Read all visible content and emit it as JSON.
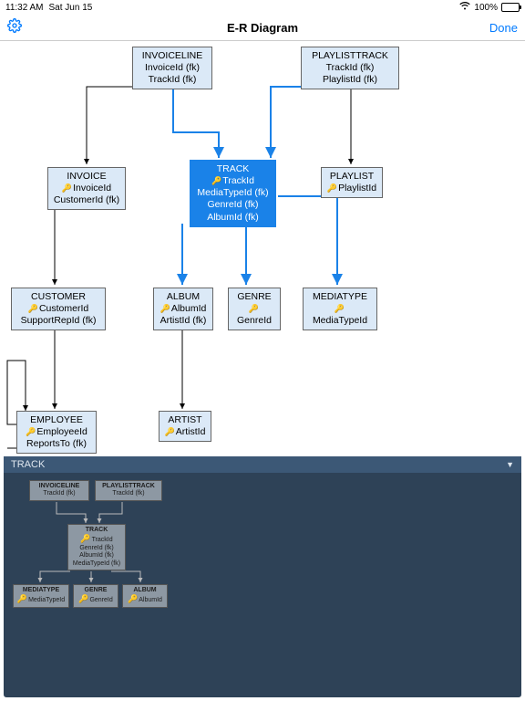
{
  "status": {
    "time": "11:32 AM",
    "date": "Sat Jun 15",
    "wifi": "wifi-icon",
    "battery_pct": "100%"
  },
  "nav": {
    "title": "E-R Diagram",
    "done": "Done"
  },
  "detail": {
    "title": "TRACK"
  },
  "entities": {
    "invoiceline": {
      "title": "INVOICELINE",
      "f1": "InvoiceId (fk)",
      "f2": "TrackId (fk)"
    },
    "playlisttrack": {
      "title": "PLAYLISTTRACK",
      "f1": "TrackId (fk)",
      "f2": "PlaylistId (fk)"
    },
    "invoice": {
      "title": "INVOICE",
      "f1": "InvoiceId",
      "f2": "CustomerId (fk)"
    },
    "track": {
      "title": "TRACK",
      "f1": "TrackId",
      "f2": "MediaTypeId (fk)",
      "f3": "GenreId (fk)",
      "f4": "AlbumId (fk)"
    },
    "playlist": {
      "title": "PLAYLIST",
      "f1": "PlaylistId"
    },
    "customer": {
      "title": "CUSTOMER",
      "f1": "CustomerId",
      "f2": "SupportRepId (fk)"
    },
    "album": {
      "title": "ALBUM",
      "f1": "AlbumId",
      "f2": "ArtistId (fk)"
    },
    "genre": {
      "title": "GENRE",
      "f1": "GenreId"
    },
    "mediatype": {
      "title": "MEDIATYPE",
      "f1": "MediaTypeId"
    },
    "employee": {
      "title": "EMPLOYEE",
      "f1": "EmployeeId",
      "f2": "ReportsTo (fk)"
    },
    "artist": {
      "title": "ARTIST",
      "f1": "ArtistId"
    }
  },
  "mini": {
    "invoiceline": {
      "title": "INVOICELINE",
      "f1": "TrackId (fk)"
    },
    "playlisttrack": {
      "title": "PLAYLISTTRACK",
      "f1": "TrackId (fk)"
    },
    "track": {
      "title": "TRACK",
      "f1": "TrackId",
      "f2": "GenreId (fk)",
      "f3": "AlbumId (fk)",
      "f4": "MediaTypeId (fk)"
    },
    "mediatype": {
      "title": "MEDIATYPE",
      "f1": "MediaTypeId"
    },
    "genre": {
      "title": "GENRE",
      "f1": "GenreId"
    },
    "album": {
      "title": "ALBUM",
      "f1": "AlbumId"
    }
  }
}
